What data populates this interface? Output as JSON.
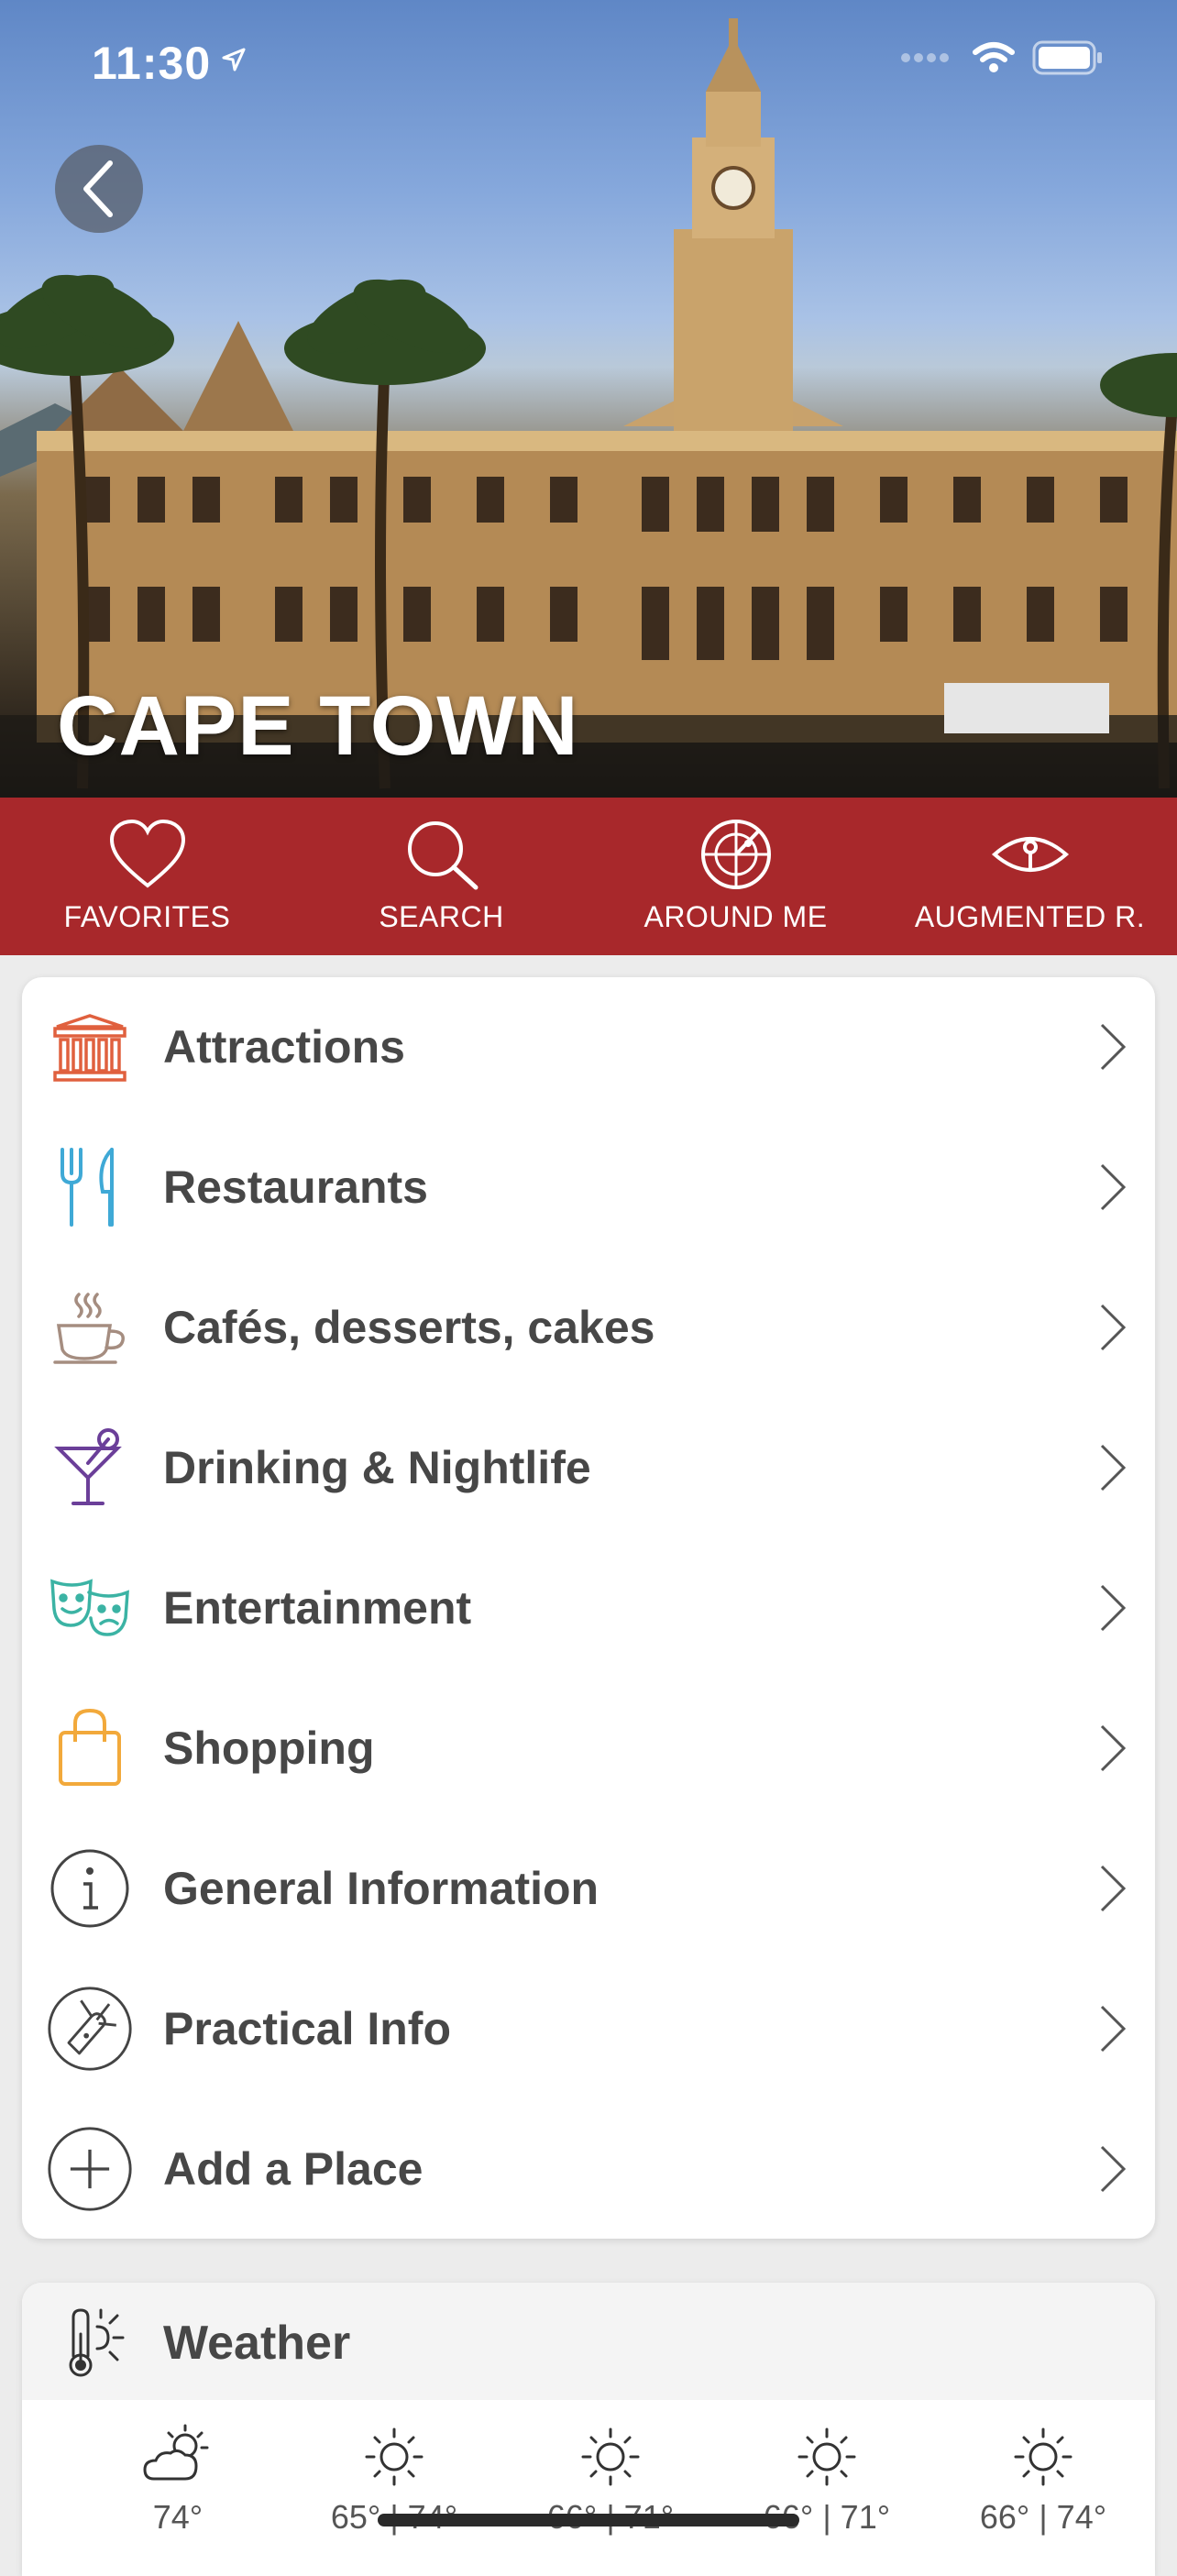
{
  "status_bar": {
    "time": "11:30"
  },
  "hero": {
    "title": "CAPE TOWN"
  },
  "toolbar": {
    "items": [
      {
        "label": "FAVORITES",
        "icon": "heart-icon"
      },
      {
        "label": "SEARCH",
        "icon": "search-icon"
      },
      {
        "label": "AROUND ME",
        "icon": "radar-icon"
      },
      {
        "label": "AUGMENTED R.",
        "icon": "eye-icon"
      }
    ],
    "color": "#a8282b"
  },
  "categories": [
    {
      "label": "Attractions",
      "icon": "museum-icon",
      "color": "#e0603e"
    },
    {
      "label": "Restaurants",
      "icon": "fork-knife-icon",
      "color": "#3fa9d6"
    },
    {
      "label": "Cafés, desserts, cakes",
      "icon": "coffee-cup-icon",
      "color": "#a58d80"
    },
    {
      "label": "Drinking & Nightlife",
      "icon": "cocktail-icon",
      "color": "#6b3f99"
    },
    {
      "label": "Entertainment",
      "icon": "theater-masks-icon",
      "color": "#3bb3a4"
    },
    {
      "label": "Shopping",
      "icon": "shopping-bag-icon",
      "color": "#f2a93b"
    },
    {
      "label": "General Information",
      "icon": "info-icon",
      "color": "#444444"
    },
    {
      "label": "Practical Info",
      "icon": "pocket-knife-icon",
      "color": "#444444"
    },
    {
      "label": "Add a Place",
      "icon": "plus-circle-icon",
      "color": "#444444"
    }
  ],
  "weather": {
    "title": "Weather",
    "days": [
      {
        "temp": "74°",
        "icon": "partly-cloudy-icon"
      },
      {
        "temp": "65° | 74°",
        "icon": "sun-icon"
      },
      {
        "temp": "66° | 71°",
        "icon": "sun-icon"
      },
      {
        "temp": "66° | 71°",
        "icon": "sun-icon"
      },
      {
        "temp": "66° | 74°",
        "icon": "sun-icon"
      }
    ]
  }
}
